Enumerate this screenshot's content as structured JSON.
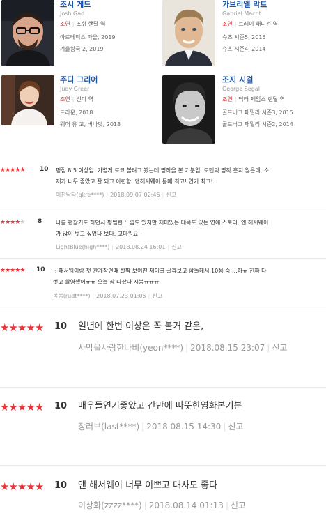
{
  "cast": [
    {
      "name": "조시 게드",
      "english_name": "Josh Gad",
      "role_type": "조연",
      "role": "조쉬 핸달 역",
      "works": [
        "아르테미스 파울, 2019",
        "겨울왕국 2, 2019"
      ],
      "icon": "actor-photo"
    },
    {
      "name": "가브리엘 막트",
      "english_name": "Gabriel Macht",
      "role_type": "조연",
      "role": "트레이 해니건 역",
      "works": [
        "슈츠 시즌5, 2015",
        "슈츠 시즌4, 2014"
      ],
      "icon": "actor-photo"
    },
    {
      "name": "주디 그리어",
      "english_name": "Judy Greer",
      "role_type": "조연",
      "role": "신디 역",
      "works": [
        "드라운, 2018",
        "웨어 유 고, 버나뎃, 2018"
      ],
      "icon": "actor-photo"
    },
    {
      "name": "조지 시걸",
      "english_name": "George Segal",
      "role_type": "조연",
      "role": "닥터 제임스 랜달 역",
      "works": [
        "골드버그 패밀리 시즌3, 2015",
        "골드버그 패밀리 시즌2, 2014"
      ],
      "icon": "actor-photo"
    }
  ],
  "reviews": [
    {
      "rating": 5,
      "score": "10",
      "lines": [
        "평점 8.5 이상임. 가볍게 로코 볼려고 봤는데 명작을 본 기분임. 로맨틱 명작 흔치 않은데, 소",
        "재가 너무 좋았고 잘 되고 아련함. 앤해서웨이 몸매 최고! 연기 최고!"
      ],
      "author": "이찬낙타(qkre****)",
      "date": "2018.09.07 02:46",
      "report": "신고"
    },
    {
      "rating": 4,
      "score": "8",
      "lines": [
        "나름 괜찮기도 하면서 평범한 느낌도 있지만 재미있는 대목도 있는 연애 스토리. 앤 해서웨이",
        "가 많이 벗고 싶었나 보다. 고마워요~"
      ],
      "author": "LightBlue(high****)",
      "date": "2018.08.24 16:01",
      "report": "신고"
    },
    {
      "rating": 5,
      "score": "10",
      "lines": [
        ";; 해서웨이랑 첫 관계장면때 살짝 보여진 제이크 골휴보고 깜놀해서 10점 줌....하ㅠ 진짜 다",
        "벗고 촬영했어ㅠㅠ 오늘 잠 다잤다 시붕ㅠㅠㅠ"
      ],
      "author": "봄봄(rudt****)",
      "date": "2018.07.23 01:05",
      "report": "신고"
    },
    {
      "rating": 5,
      "score": "10",
      "lines": [
        "일년에 한번 이상은 꼭 볼거 같은,"
      ],
      "author": "사막을사랑한나비(yeon****)",
      "date": "2018.08.15 23:07",
      "report": "신고"
    },
    {
      "rating": 5,
      "score": "10",
      "lines": [
        "배우들연기좋았고 간만에 따뜻한영화본기분"
      ],
      "author": "장러브(last****)",
      "date": "2018.08.15 14:30",
      "report": "신고"
    },
    {
      "rating": 5,
      "score": "10",
      "lines": [
        "앤 해서웨이 너무 이쁘고 대사도 좋다"
      ],
      "author": "이상화(zzzz****)",
      "date": "2018.08.14 01:13",
      "report": "신고"
    }
  ],
  "colors": {
    "star_on": "#e8333a",
    "star_off": "#cfcfcf",
    "name_link": "#1d55a8",
    "role_type": "#d33333"
  }
}
